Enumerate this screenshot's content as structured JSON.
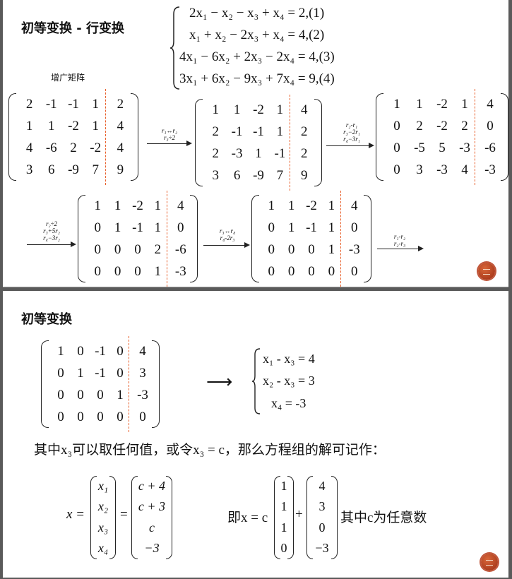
{
  "slide1": {
    "title": "初等变换 - 行变换",
    "aug_label": "增广矩阵",
    "system": [
      "2x₁ − x₂ − x₃ + x₄ = 2,(1)",
      "x₁ + x₂ − 2x₃ + x₄ = 4,(2)",
      "4x₁ − 6x₂ + 2x₃ − 2x₄ = 4,(3)",
      "3x₁ + 6x₂ − 9x₃ + 7x₄ = 9,(4)"
    ],
    "m1": [
      [
        "2",
        "-1",
        "-1",
        "1",
        "2"
      ],
      [
        "1",
        "1",
        "-2",
        "1",
        "4"
      ],
      [
        "4",
        "-6",
        "2",
        "-2",
        "4"
      ],
      [
        "3",
        "6",
        "-9",
        "7",
        "9"
      ]
    ],
    "m2": [
      [
        "1",
        "1",
        "-2",
        "1",
        "4"
      ],
      [
        "2",
        "-1",
        "-1",
        "1",
        "2"
      ],
      [
        "2",
        "-3",
        "1",
        "-1",
        "2"
      ],
      [
        "3",
        "6",
        "-9",
        "7",
        "9"
      ]
    ],
    "m3": [
      [
        "1",
        "1",
        "-2",
        "1",
        "4"
      ],
      [
        "0",
        "2",
        "-2",
        "2",
        "0"
      ],
      [
        "0",
        "-5",
        "5",
        "-3",
        "-6"
      ],
      [
        "0",
        "3",
        "-3",
        "4",
        "-3"
      ]
    ],
    "m4": [
      [
        "1",
        "1",
        "-2",
        "1",
        "4"
      ],
      [
        "0",
        "1",
        "-1",
        "1",
        "0"
      ],
      [
        "0",
        "0",
        "0",
        "2",
        "-6"
      ],
      [
        "0",
        "0",
        "0",
        "1",
        "-3"
      ]
    ],
    "m5": [
      [
        "1",
        "1",
        "-2",
        "1",
        "4"
      ],
      [
        "0",
        "1",
        "-1",
        "1",
        "0"
      ],
      [
        "0",
        "0",
        "0",
        "1",
        "-3"
      ],
      [
        "0",
        "0",
        "0",
        "0",
        "0"
      ]
    ],
    "op1": [
      "r₁↔r₂",
      "r₃÷2"
    ],
    "op2": [
      "r₂-r₁",
      "r₃−2r₁",
      "r₄−3r₁"
    ],
    "op3": [
      "r₂÷2",
      "r₃+5r₂",
      "r₄−3r₂"
    ],
    "op4": [
      "r₃↔r₄",
      "r₄-2r₃"
    ],
    "op5": [
      "r₁-r₂",
      "r₂-r₃"
    ]
  },
  "slide2": {
    "title": "初等变换",
    "m6": [
      [
        "1",
        "0",
        "-1",
        "0",
        "4"
      ],
      [
        "0",
        "1",
        "-1",
        "0",
        "3"
      ],
      [
        "0",
        "0",
        "0",
        "1",
        "-3"
      ],
      [
        "0",
        "0",
        "0",
        "0",
        "0"
      ]
    ],
    "arrow": "⟶",
    "system": [
      "x₁ - x₃ = 4",
      "x₂ - x₃ = 3",
      "x₄ = -3"
    ],
    "sentence": "其中x₃可以取任何值，或令x₃ = c，那么方程组的解可记作：",
    "x_label": "x =",
    "eq_sign": "=",
    "xvec": [
      "x₁",
      "x₂",
      "x₃",
      "x₄"
    ],
    "cvec": [
      "c + 4",
      "c + 3",
      "c",
      "−3"
    ],
    "prefix": "即x = c",
    "v1": [
      "1",
      "1",
      "1",
      "0"
    ],
    "plus": "+",
    "v2": [
      "4",
      "3",
      "0",
      "−3"
    ],
    "suffix": "其中c为任意数"
  },
  "colors": {
    "accent": "#e8602c",
    "badge": "#b8401f"
  }
}
